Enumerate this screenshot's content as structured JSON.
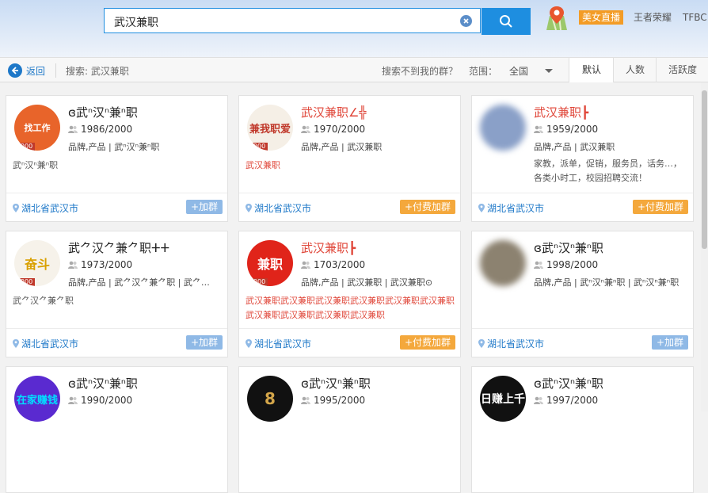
{
  "search": {
    "value": "武汉兼职",
    "placeholder": ""
  },
  "header": {
    "live_label": "美女直播",
    "game_link": "王者荣耀",
    "tfbc_link": "TFBC"
  },
  "toolbar": {
    "back_label": "返回",
    "search_label": "搜索: 武汉兼职",
    "not_found": "搜索不到我的群？",
    "range_label": "范围：",
    "range_value": "全国",
    "tabs": [
      {
        "label": "默认",
        "active": true
      },
      {
        "label": "人数",
        "active": false
      },
      {
        "label": "活跃度",
        "active": false
      }
    ]
  },
  "cards": [
    {
      "name": "ɞ武ⁿ汉ⁿ兼ⁿ职",
      "members": "1986/2000",
      "tags": "品牌,产品 | 武ⁿ汉ⁿ兼ⁿ职",
      "desc": "武ⁿ汉ⁿ兼ⁿ职",
      "location": "湖北省武汉市",
      "join": "+加群",
      "avatar_text": "找工作",
      "level": "2000",
      "name_color": "dark"
    },
    {
      "name": "武汉兼职∠╬",
      "members": "1970/2000",
      "tags": "品牌,产品 | 武汉兼职",
      "desc": "武汉兼职",
      "location": "湖北省武汉市",
      "join": "+付费加群",
      "avatar_text": "兼我职爱",
      "level": "2000",
      "name_color": "red"
    },
    {
      "name": "武汉兼职┣",
      "members": "1959/2000",
      "tags": "品牌,产品 | 武汉兼职",
      "desc": "家教，派单，促销，服务员，话务…，各类小时工，校园招聘交流！",
      "location": "湖北省武汉市",
      "join": "+付费加群",
      "avatar_text": "",
      "level": "",
      "name_color": "red"
    },
    {
      "name": "武⺈汉⺈兼⺈职ⵜⵜ",
      "members": "1973/2000",
      "tags": "品牌,产品 | 武⺈汉⺈兼⺈职 | 武⺈…",
      "desc": "武⺈汉⺈兼⺈职",
      "location": "湖北省武汉市",
      "join": "+加群",
      "avatar_text": "奋斗",
      "level": "2000",
      "name_color": "dark"
    },
    {
      "name": "武汉兼职┣",
      "members": "1703/2000",
      "tags": "品牌,产品 | 武汉兼职 | 武汉兼职⊙",
      "desc": "武汉兼职武汉兼职武汉兼职武汉兼职武汉兼职武汉兼职武汉兼职武汉兼职武汉兼职武汉兼职",
      "location": "湖北省武汉市",
      "join": "+付费加群",
      "avatar_text": "兼职",
      "level": "2000",
      "name_color": "red"
    },
    {
      "name": "ɞ武ⁿ汉ⁿ兼ⁿ职",
      "members": "1998/2000",
      "tags": "品牌,产品 | 武ⁿ汉ⁿ兼ⁿ职 | 武ⁿ汉ⁿ兼ⁿ职",
      "desc": "",
      "location": "湖北省武汉市",
      "join": "+加群",
      "avatar_text": "",
      "level": "",
      "name_color": "dark"
    },
    {
      "name": "ɞ武ⁿ汉ⁿ兼ⁿ职",
      "members": "1990/2000",
      "tags": "",
      "desc": "",
      "location": "",
      "join": "",
      "avatar_text": "在家赚钱",
      "level": "",
      "name_color": "dark"
    },
    {
      "name": "ɞ武ⁿ汉ⁿ兼ⁿ职",
      "members": "1995/2000",
      "tags": "",
      "desc": "",
      "location": "",
      "join": "",
      "avatar_text": "8",
      "level": "",
      "name_color": "dark"
    },
    {
      "name": "ɞ武ⁿ汉ⁿ兼ⁿ职",
      "members": "1997/2000",
      "tags": "",
      "desc": "",
      "location": "",
      "join": "",
      "avatar_text": "日赚上千",
      "level": "",
      "name_color": "dark"
    }
  ]
}
